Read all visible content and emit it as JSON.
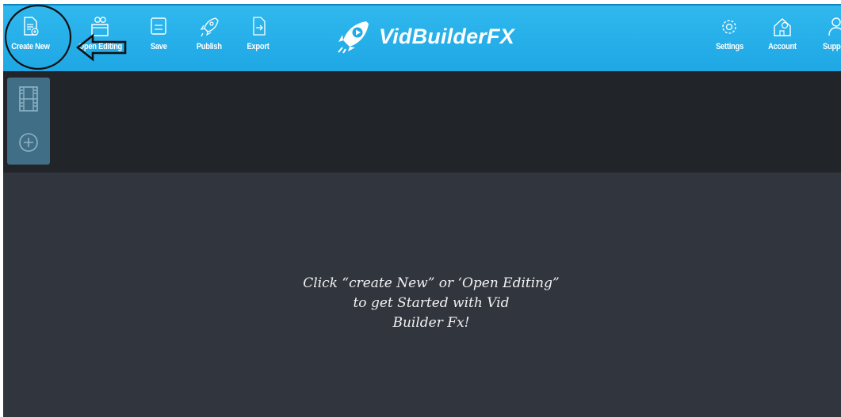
{
  "toolbar": {
    "create_new": "Create New",
    "open_editing": "Open Editing",
    "save": "Save",
    "publish": "Publish",
    "export": "Export",
    "settings": "Settings",
    "account": "Account",
    "support": "Support"
  },
  "brand": {
    "name": "VidBuilderFX",
    "colors": {
      "toolbar": "#22abe7",
      "timeline": "#212429",
      "canvas": "#31353d",
      "side_panel": "#3f6e86"
    }
  },
  "icons": {
    "create_new": "new-document-icon",
    "open_editing": "users-folder-icon",
    "save": "save-icon",
    "publish": "rocket-icon",
    "export": "export-icon",
    "settings": "gear-icon",
    "account": "home-account-icon",
    "support": "support-icon",
    "film": "film-strip-icon",
    "add": "plus-circle-icon"
  },
  "canvas": {
    "hint": "Click “create New” or ‘Open Editing”\nto get Started with Vid\nBuilder Fx!"
  }
}
